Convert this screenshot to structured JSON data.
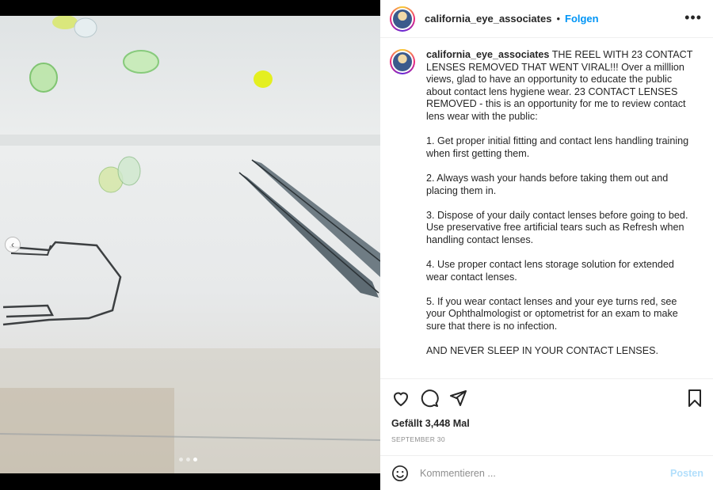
{
  "post": {
    "username": "california_eye_associates",
    "separator": "•",
    "follow_label": "Folgen",
    "more_icon": "more-dots-icon",
    "more_glyph": "•••"
  },
  "caption": {
    "username": "california_eye_associates",
    "intro": "THE REEL WITH 23 CONTACT LENSES REMOVED THAT WENT VIRAL!!! Over a milllion views, glad to have an opportunity to educate the public about contact lens hygiene wear. 23 CONTACT LENSES REMOVED - this is an opportunity for me to review contact lens wear with the public:",
    "points": [
      "1. Get proper initial fitting and contact lens handling training when first getting them.",
      "2. Always wash your hands before taking them out and placing them in.",
      "3. Dispose of your daily contact lenses before going to bed. Use preservative free artificial tears such as Refresh when handling contact lenses.",
      "4. Use proper contact lens storage solution for extended wear contact lenses.",
      "5. If you wear contact lenses and your eye turns red, see your Ophthalmologist or optometrist for an exam to make sure that there is no infection."
    ],
    "closing": "AND NEVER SLEEP IN YOUR CONTACT LENSES."
  },
  "actions": {
    "icons": [
      "heart-icon",
      "comment-icon",
      "share-icon",
      "bookmark-icon"
    ],
    "likes": "Gefällt 3,448 Mal",
    "date": "SEPTEMBER 30"
  },
  "comment": {
    "placeholder": "Kommentieren ...",
    "post_label": "Posten",
    "emoji_icon": "emoji-icon"
  },
  "media": {
    "prev_glyph": "‹",
    "carousel_dots": 3,
    "active_dot": 2
  }
}
